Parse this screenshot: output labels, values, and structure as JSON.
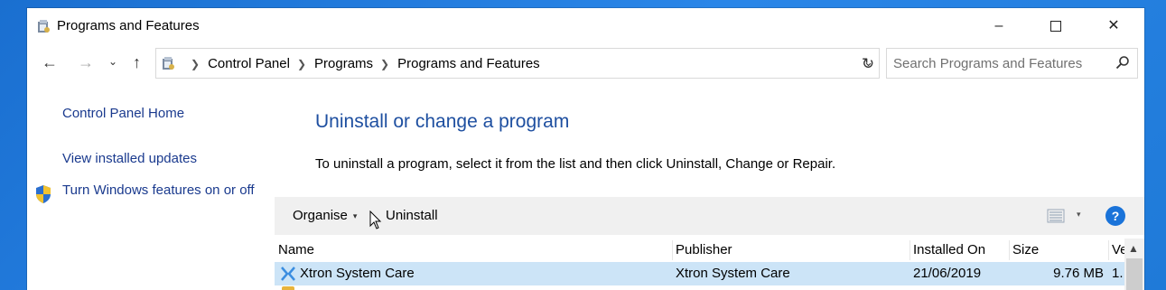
{
  "window": {
    "title": "Programs and Features",
    "controls": {
      "minimize": "–",
      "close": "✕"
    }
  },
  "nav": {
    "back": "←",
    "forward": "→",
    "recent": "⌄",
    "up": "↑",
    "breadcrumbs": [
      "Control Panel",
      "Programs",
      "Programs and Features"
    ],
    "refresh": "↻",
    "dropdown": "⌄",
    "search_placeholder": "Search Programs and Features"
  },
  "sidebar": {
    "home": "Control Panel Home",
    "updates": "View installed updates",
    "features": "Turn Windows features on or off"
  },
  "main": {
    "heading": "Uninstall or change a program",
    "description": "To uninstall a program, select it from the list and then click Uninstall, Change or Repair."
  },
  "toolbar": {
    "organise": "Organise",
    "uninstall": "Uninstall",
    "help": "?"
  },
  "list": {
    "columns": [
      "Name",
      "Publisher",
      "Installed On",
      "Size",
      "Ve"
    ],
    "rows": [
      {
        "name": "Xtron System Care",
        "publisher": "Xtron System Care",
        "installed_on": "21/06/2019",
        "size": "9.76 MB",
        "version": "1."
      }
    ]
  },
  "colors": {
    "link": "#1a3a8e",
    "heading": "#1e4fa0",
    "selected_row": "#cce4f7",
    "help_button": "#1a73d9",
    "desktop": "#1f7ad8"
  }
}
